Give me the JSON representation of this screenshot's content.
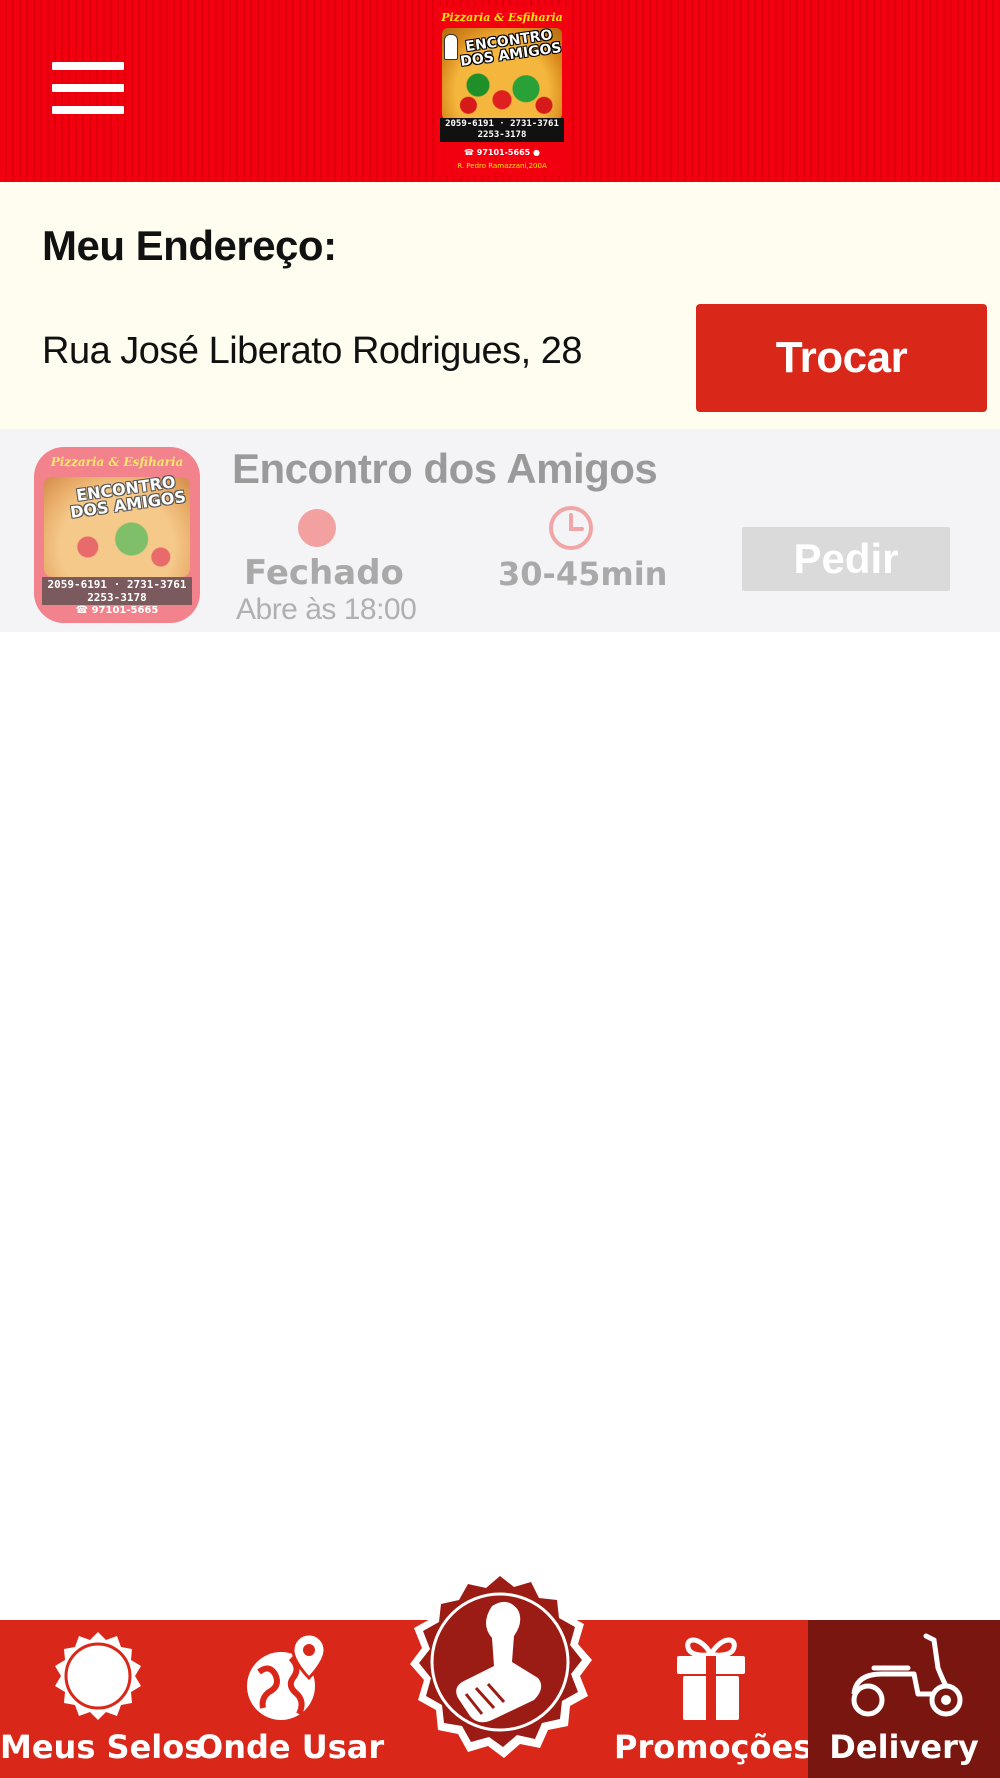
{
  "header": {
    "menu_icon": "hamburger-menu-icon",
    "logo": {
      "subtitle": "Pizzaria & Esfiharia",
      "title_line1": "ENCONTRO",
      "title_line2": "DOS AMIGOS",
      "phones_line1": "2059-6191 · 2731-3761",
      "phones_line2": "2253-3178",
      "whatsapp": "97101-5665",
      "address": "R. Pedro Ramazzani,200A"
    }
  },
  "address": {
    "title": "Meu Endereço:",
    "value": "Rua José Liberato Rodrigues, 28",
    "change_label": "Trocar"
  },
  "store": {
    "name": "Encontro dos Amigos",
    "status": "Fechado",
    "opens_at": "Abre às 18:00",
    "delivery_time": "30-45min",
    "order_label": "Pedir",
    "status_color": "#f2a0a0"
  },
  "bottom_nav": {
    "items": [
      {
        "label": "Meus Selos",
        "icon": "seal-badge-icon"
      },
      {
        "label": "Onde Usar",
        "icon": "globe-location-icon"
      },
      {
        "label": "",
        "icon": "stamp-icon"
      },
      {
        "label": "Promoções",
        "icon": "gift-icon"
      },
      {
        "label": "Delivery",
        "icon": "scooter-icon",
        "active": true
      }
    ]
  },
  "colors": {
    "brand_red": "#d92719",
    "header_red": "#f2000f",
    "active_tab": "#7a1610",
    "address_bg": "#fefdf0"
  }
}
